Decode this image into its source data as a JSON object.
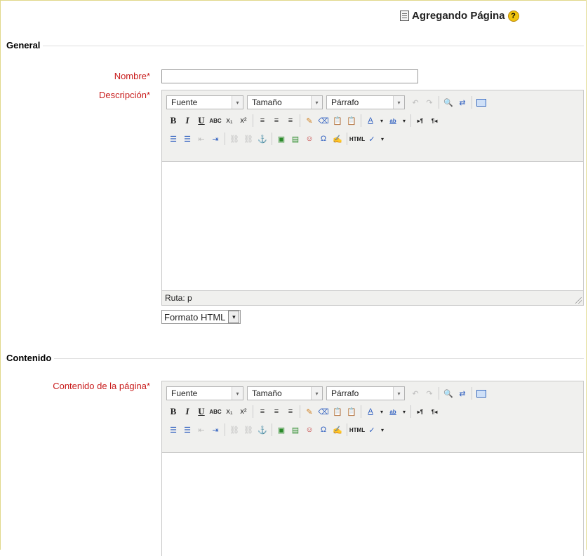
{
  "header": {
    "title": "Agregando Página",
    "help_symbol": "?"
  },
  "sections": {
    "general": "General",
    "contenido": "Contenido"
  },
  "fields": {
    "nombre_label": "Nombre",
    "descripcion_label": "Descripción",
    "contenido_label": "Contenido de la página",
    "required_mark": "*",
    "nombre_value": ""
  },
  "editor": {
    "font_select": "Fuente",
    "size_select": "Tamaño",
    "format_select": "Párrafo",
    "status_path": "Ruta: p"
  },
  "format": {
    "selected": "Formato HTML"
  },
  "toolbar_icons": {
    "bold": "B",
    "italic": "I",
    "underline": "U",
    "strike": "ABC",
    "subscript": "x₁",
    "superscript": "x²",
    "omega": "Ω",
    "html": "HTML",
    "text_color": "A",
    "highlight": "ab"
  }
}
